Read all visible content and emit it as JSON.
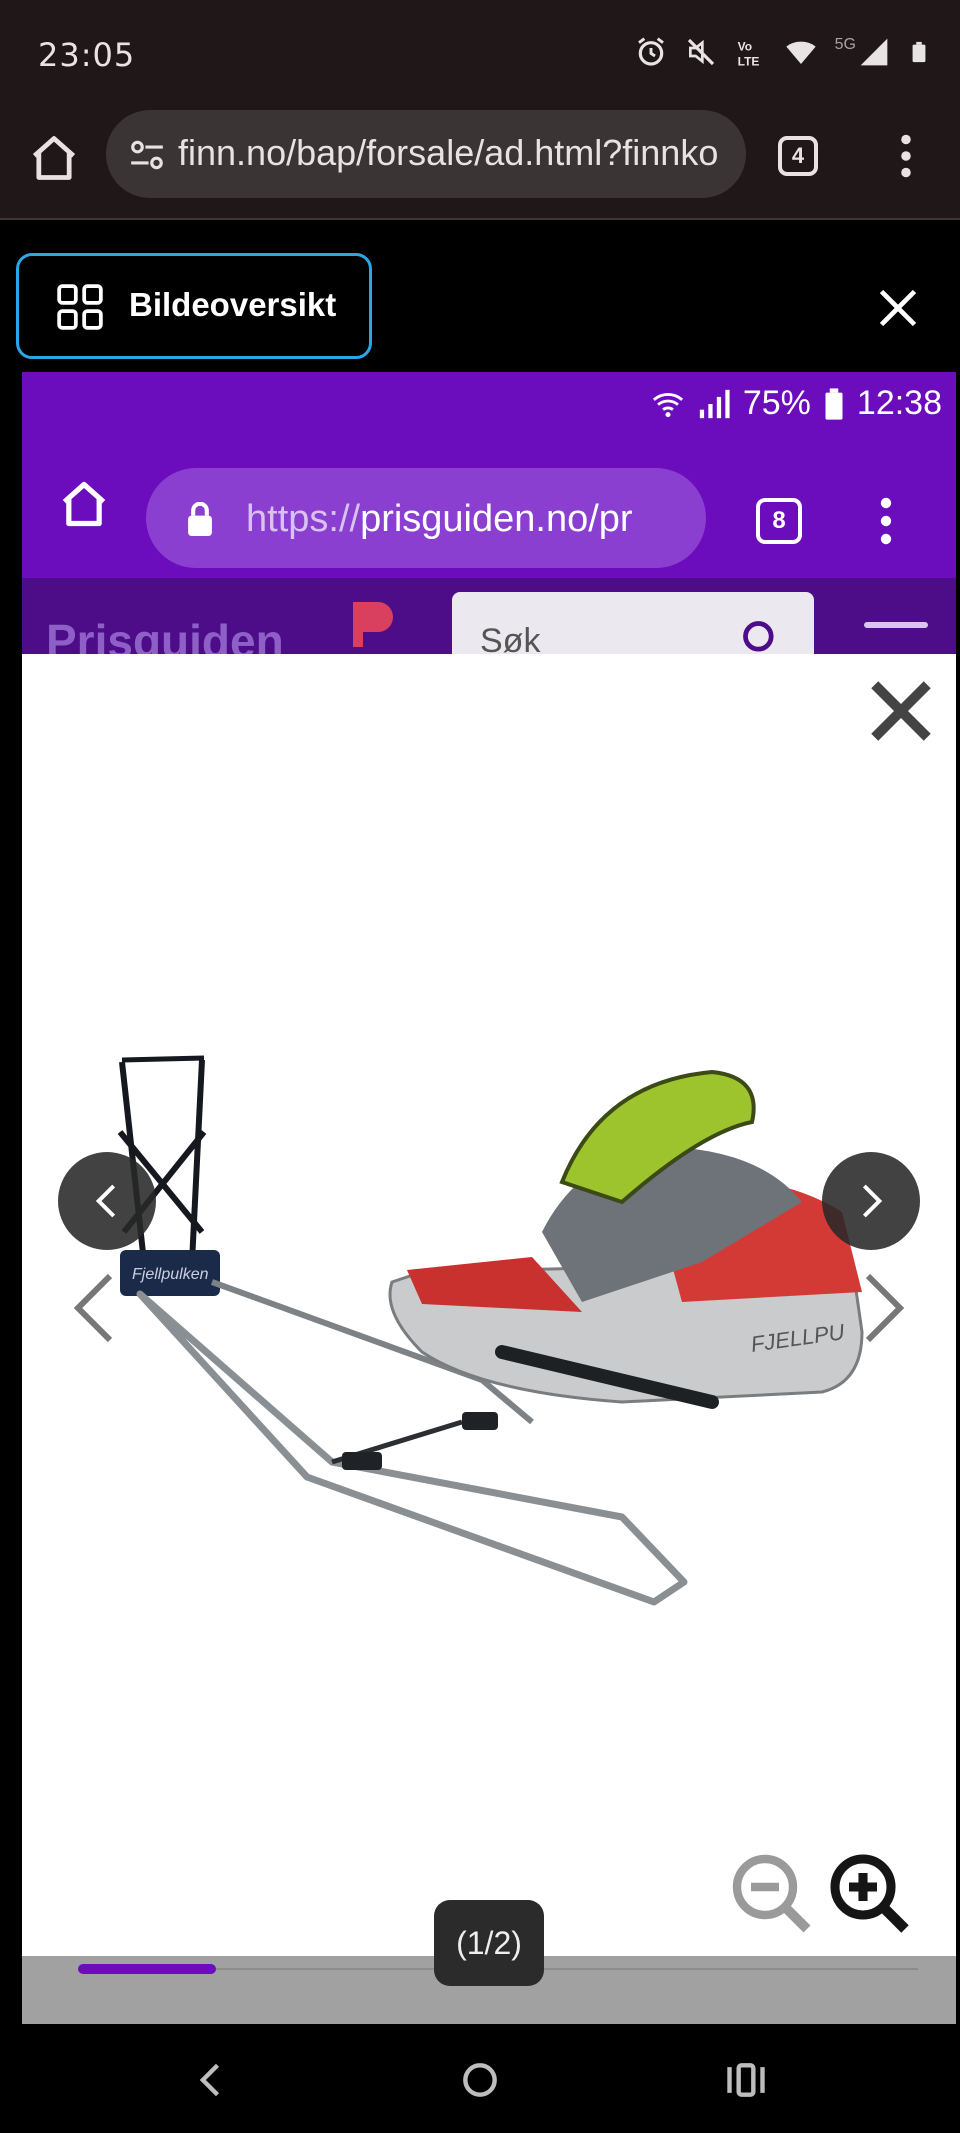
{
  "status_bar": {
    "time": "23:05",
    "network": "5G"
  },
  "browser": {
    "url": "finn.no/bap/forsale/ad.html?finnko",
    "tab_count": "4"
  },
  "gallery_header": {
    "overview_label": "Bildeoversikt"
  },
  "embedded_screenshot": {
    "status": {
      "battery": "75%",
      "time": "12:38"
    },
    "url_prefix": "https://",
    "url_host": "prisguiden.no/pr",
    "tab_count": "8",
    "site_logo": "Prisguiden",
    "search_placeholder": "Søk"
  },
  "viewer": {
    "counter": "(1/2)"
  },
  "colors": {
    "accent": "#6b0dbd",
    "focus_ring": "#2ba6e8"
  }
}
